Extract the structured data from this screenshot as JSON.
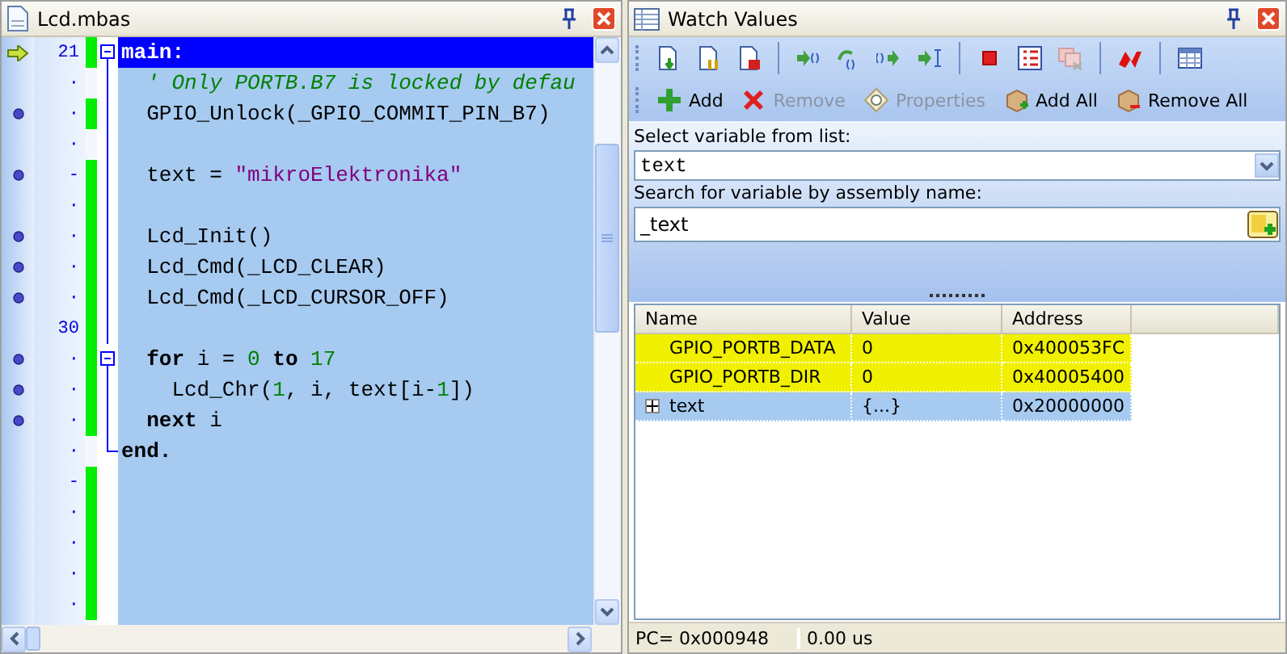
{
  "editor": {
    "title": "Lcd.mbas",
    "lines": [
      {
        "execution_point": true,
        "executable": false,
        "number": "21",
        "modified": true,
        "fold_box": true,
        "current": true,
        "code": [
          {
            "kind": "label",
            "text": "main:"
          }
        ]
      },
      {
        "execution_point": false,
        "executable": false,
        "number": "·",
        "modified": false,
        "fold_box": false,
        "current": false,
        "code": [
          {
            "kind": "comment",
            "text": "  ' Only PORTB.B7 is locked by defau"
          }
        ]
      },
      {
        "execution_point": false,
        "executable": true,
        "number": "·",
        "modified": true,
        "fold_box": false,
        "current": false,
        "code": [
          {
            "kind": "plain",
            "text": "  GPIO_Unlock(_GPIO_COMMIT_PIN_B7)"
          }
        ]
      },
      {
        "execution_point": false,
        "executable": false,
        "number": "·",
        "modified": false,
        "fold_box": false,
        "current": false
      },
      {
        "execution_point": false,
        "executable": true,
        "number": "-",
        "modified": true,
        "fold_box": false,
        "current": false,
        "code": [
          {
            "kind": "plain",
            "text": "  text = "
          },
          {
            "kind": "string",
            "text": "\"mikroElektronika\""
          }
        ]
      },
      {
        "execution_point": false,
        "executable": false,
        "number": "·",
        "modified": true,
        "fold_box": false,
        "current": false
      },
      {
        "execution_point": false,
        "executable": true,
        "number": "·",
        "modified": true,
        "fold_box": false,
        "current": false,
        "code": [
          {
            "kind": "plain",
            "text": "  Lcd_Init()"
          }
        ]
      },
      {
        "execution_point": false,
        "executable": true,
        "number": "·",
        "modified": true,
        "fold_box": false,
        "current": false,
        "code": [
          {
            "kind": "plain",
            "text": "  Lcd_Cmd(_LCD_CLEAR)"
          }
        ]
      },
      {
        "execution_point": false,
        "executable": true,
        "number": "·",
        "modified": true,
        "fold_box": false,
        "current": false,
        "code": [
          {
            "kind": "plain",
            "text": "  Lcd_Cmd(_LCD_CURSOR_OFF)"
          }
        ]
      },
      {
        "execution_point": false,
        "executable": false,
        "number": "30",
        "modified": true,
        "fold_box": false,
        "current": false
      },
      {
        "execution_point": false,
        "executable": true,
        "number": "·",
        "modified": true,
        "fold_box": true,
        "current": false,
        "code": [
          {
            "kind": "keyword",
            "text": "  for"
          },
          {
            "kind": "plain",
            "text": " i = "
          },
          {
            "kind": "number",
            "text": "0"
          },
          {
            "kind": "keyword",
            "text": " to"
          },
          {
            "kind": "number",
            "text": " 17"
          }
        ]
      },
      {
        "execution_point": false,
        "executable": true,
        "number": "·",
        "modified": true,
        "fold_box": false,
        "current": false,
        "code": [
          {
            "kind": "plain",
            "text": "    Lcd_Chr("
          },
          {
            "kind": "number",
            "text": "1"
          },
          {
            "kind": "plain",
            "text": ", i, text[i-"
          },
          {
            "kind": "number",
            "text": "1"
          },
          {
            "kind": "plain",
            "text": "])"
          }
        ]
      },
      {
        "execution_point": false,
        "executable": true,
        "number": "·",
        "modified": true,
        "fold_box": false,
        "current": false,
        "code": [
          {
            "kind": "keyword",
            "text": "  next"
          },
          {
            "kind": "plain",
            "text": " i"
          }
        ]
      },
      {
        "execution_point": false,
        "executable": false,
        "number": "·",
        "modified": false,
        "fold_box": false,
        "fold_end": true,
        "current": false,
        "code": [
          {
            "kind": "keyword",
            "text": "end."
          }
        ]
      },
      {
        "execution_point": false,
        "executable": false,
        "number": "-",
        "modified": true,
        "fold_box": false,
        "current": false
      },
      {
        "execution_point": false,
        "executable": false,
        "number": "·",
        "modified": true,
        "fold_box": false,
        "current": false
      },
      {
        "execution_point": false,
        "executable": false,
        "number": "·",
        "modified": true,
        "fold_box": false,
        "current": false
      },
      {
        "execution_point": false,
        "executable": false,
        "number": "·",
        "modified": true,
        "fold_box": false,
        "current": false
      },
      {
        "execution_point": false,
        "executable": false,
        "number": "·",
        "modified": true,
        "fold_box": false,
        "current": false
      }
    ]
  },
  "watch": {
    "title": "Watch Values",
    "actions": [
      {
        "kind": "add",
        "label": "Add",
        "disabled": false
      },
      {
        "kind": "remove",
        "label": "Remove",
        "disabled": true
      },
      {
        "kind": "properties",
        "label": "Properties",
        "disabled": true
      },
      {
        "kind": "add-all",
        "label": "Add All",
        "disabled": false
      },
      {
        "kind": "remove-all",
        "label": "Remove All",
        "disabled": false
      }
    ],
    "select_label": "Select variable from list:",
    "select_value": "text",
    "search_label": "Search for variable by assembly name:",
    "search_value": "_text",
    "columns": [
      "Name",
      "Value",
      "Address"
    ],
    "rows": [
      {
        "name": "GPIO_PORTB_DATA",
        "value": "0",
        "address": "0x400053FC",
        "changed": true,
        "selected": false,
        "expandable": false
      },
      {
        "name": "GPIO_PORTB_DIR",
        "value": "0",
        "address": "0x40005400",
        "changed": true,
        "selected": false,
        "expandable": false
      },
      {
        "name": "text",
        "value": "{...}",
        "address": "0x20000000",
        "changed": false,
        "selected": true,
        "expandable": true
      }
    ]
  },
  "status_bar": {
    "pc": "PC= 0x000948",
    "time": "0.00 us"
  }
}
